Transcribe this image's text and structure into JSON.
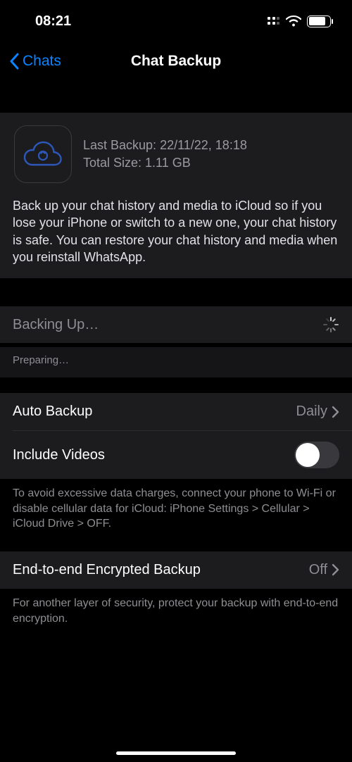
{
  "status": {
    "time": "08:21"
  },
  "nav": {
    "back_label": "Chats",
    "title": "Chat Backup"
  },
  "backup_info": {
    "last_backup_label": "Last Backup: 22/11/22, 18:18",
    "total_size_label": "Total Size: 1.11 GB",
    "description": "Back up your chat history and media to iCloud so if you lose your iPhone or switch to a new one, your chat history is safe. You can restore your chat history and media when you reinstall WhatsApp."
  },
  "progress": {
    "status_label": "Backing Up…",
    "substatus_label": "Preparing…"
  },
  "settings": {
    "auto_backup": {
      "label": "Auto Backup",
      "value": "Daily"
    },
    "include_videos": {
      "label": "Include Videos",
      "on": false
    },
    "data_warning": "To avoid excessive data charges, connect your phone to Wi-Fi or disable cellular data for iCloud: iPhone Settings > Cellular > iCloud Drive > OFF.",
    "e2e": {
      "label": "End-to-end Encrypted Backup",
      "value": "Off"
    },
    "e2e_hint": "For another layer of security, protect your backup with end-to-end encryption."
  },
  "colors": {
    "accent": "#0a84ff",
    "bg": "#000000",
    "card": "#1c1c1e",
    "muted": "#8e8e93"
  }
}
